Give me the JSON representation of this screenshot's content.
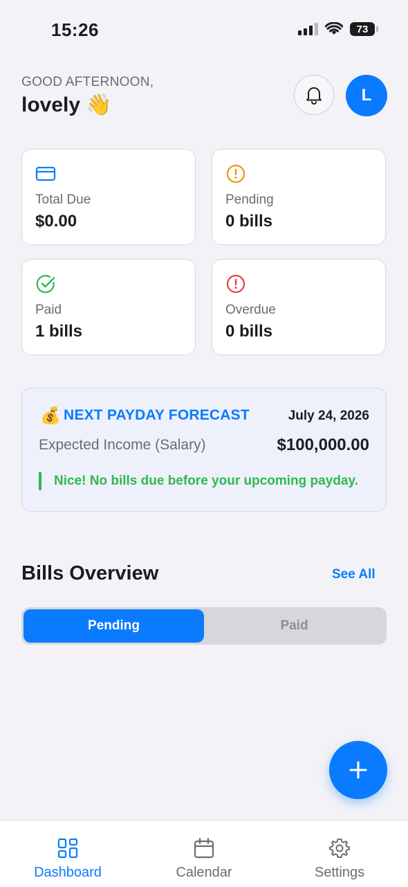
{
  "status_bar": {
    "time": "15:26",
    "battery": "73"
  },
  "header": {
    "greeting": "GOOD AFTERNOON,",
    "username": "lovely 👋",
    "avatar_initial": "L"
  },
  "stats": [
    {
      "icon": "credit-card-icon",
      "label": "Total Due",
      "value": "$0.00"
    },
    {
      "icon": "alert-circle-icon",
      "label": "Pending",
      "value": "0 bills"
    },
    {
      "icon": "check-circle-icon",
      "label": "Paid",
      "value": "1 bills"
    },
    {
      "icon": "alert-circle-icon",
      "label": "Overdue",
      "value": "0 bills"
    }
  ],
  "forecast": {
    "emoji": "💰",
    "title": "NEXT PAYDAY FORECAST",
    "date": "July 24, 2026",
    "income_label": "Expected Income (Salary)",
    "income_value": "$100,000.00",
    "note": "Nice! No bills due before your upcoming payday."
  },
  "bills_overview": {
    "title": "Bills Overview",
    "see_all": "See All",
    "segments": [
      "Pending",
      "Paid"
    ],
    "selected": "Pending"
  },
  "tabs": [
    {
      "label": "Dashboard",
      "icon": "grid-icon",
      "active": true
    },
    {
      "label": "Calendar",
      "icon": "calendar-icon",
      "active": false
    },
    {
      "label": "Settings",
      "icon": "gear-icon",
      "active": false
    }
  ],
  "colors": {
    "accent": "#0a7aff",
    "pending": "#f0960a",
    "paid": "#2fb84f",
    "overdue": "#e5423a",
    "background": "#f2f2f7"
  }
}
